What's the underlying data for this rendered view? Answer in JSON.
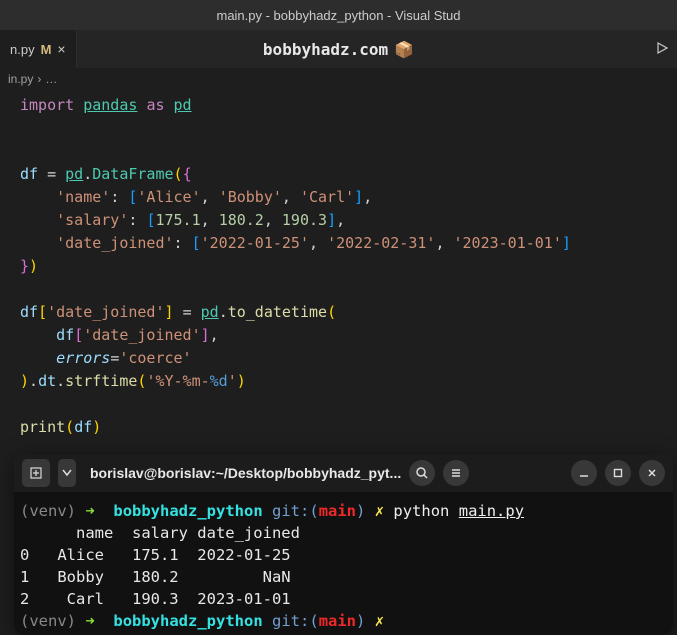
{
  "window": {
    "title": "main.py - bobbyhadz_python - Visual Stud"
  },
  "tab": {
    "name": "n.py",
    "modified": "M",
    "close": "×"
  },
  "brand": {
    "text": "bobbyhadz.com",
    "icon": "📦"
  },
  "breadcrumb": {
    "file": "in.py",
    "sep": "›",
    "more": "…"
  },
  "code": {
    "import": "import",
    "pandas": "pandas",
    "as": "as",
    "pd": "pd",
    "df": "df",
    "eq": "=",
    "dot": ".",
    "DataFrame": "DataFrame",
    "lp": "(",
    "rp": ")",
    "lb": "{",
    "rb": "}",
    "ls": "[",
    "rs": "]",
    "name_key": "'name'",
    "colon": ":",
    "comma": ",",
    "alice": "'Alice'",
    "bobby": "'Bobby'",
    "carl": "'Carl'",
    "salary_key": "'salary'",
    "s1": "175.1",
    "s2": "180.2",
    "s3": "190.3",
    "date_key": "'date_joined'",
    "d1": "'2022-01-25'",
    "d2": "'2022-02-31'",
    "d3": "'2023-01-01'",
    "to_datetime": "to_datetime",
    "errors": "errors",
    "coerce": "'coerce'",
    "dt": "dt",
    "strftime": "strftime",
    "fmt_pre": "'%Y-%m-",
    "fmt_d": "%d",
    "fmt_post": "'",
    "print": "print"
  },
  "terminal": {
    "title": "borislav@borislav:~/Desktop/bobbyhadz_pyt...",
    "venv": "(venv)",
    "arrow": "➜",
    "dir": "bobbyhadz_python",
    "git_pre": "git:(",
    "branch": "main",
    "git_post": ")",
    "dirty": "✗",
    "cmd_python": "python",
    "cmd_file": "main.py",
    "header": "      name  salary date_joined",
    "row0": "0   Alice   175.1  2022-01-25",
    "row1": "1   Bobby   180.2         NaN",
    "row2": "2    Carl   190.3  2023-01-01"
  }
}
